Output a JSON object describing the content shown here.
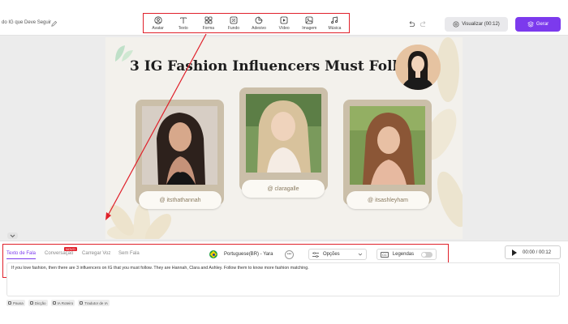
{
  "header": {
    "project_title": "do IG que Deve Seguir",
    "tools": [
      {
        "label": "Avatar",
        "icon": "avatar-icon"
      },
      {
        "label": "Texto",
        "icon": "text-icon"
      },
      {
        "label": "Forma",
        "icon": "shape-icon"
      },
      {
        "label": "Fundo",
        "icon": "background-icon"
      },
      {
        "label": "Adesivo",
        "icon": "sticker-icon"
      },
      {
        "label": "Vídeo",
        "icon": "video-icon"
      },
      {
        "label": "Imagem",
        "icon": "image-icon"
      },
      {
        "label": "Música",
        "icon": "music-icon"
      }
    ],
    "preview_label": "Visualizar (00:12)",
    "generate_label": "Gerar"
  },
  "slide": {
    "title": "3 IG Fashion Influencers Must Follow",
    "influencers": [
      {
        "handle": "@ itsthathannah"
      },
      {
        "handle": "@ claragalle"
      },
      {
        "handle": "@ itsashleyham"
      }
    ]
  },
  "speech_panel": {
    "tabs": [
      "Texto de Fala",
      "Conversação",
      "Carregar Voz",
      "Sem Fala"
    ],
    "active_tab": 0,
    "new_badge": "NOVO",
    "voice": "Portuguese(BR) - Yara",
    "options_label": "Opções",
    "legend_label": "Legendas",
    "legend_enabled": false,
    "time_display": "00:00 / 00:12",
    "script_text": "If you love fashion, then there are 3 influencers on IG that you must follow. They are Hannah, Clara and Ashley. Follow them to know more fashion matching.",
    "chips": [
      "Pausa",
      "Dicção",
      "IA Roteiro",
      "Tradutor de IA"
    ]
  },
  "colors": {
    "accent": "#7c3aed",
    "highlight_box": "#e0202a",
    "card": "#cbbfa9",
    "slide_bg": "#f3f1ec"
  }
}
